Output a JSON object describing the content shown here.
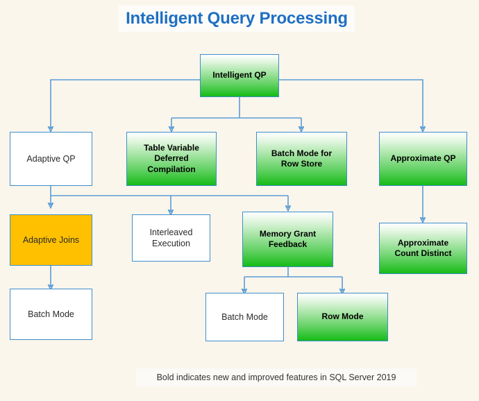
{
  "header": {
    "title": "Intelligent Query Processing"
  },
  "footer": {
    "caption": "Bold indicates new and improved features in SQL Server 2019"
  },
  "colors": {
    "background": "#faf6ec",
    "title_text": "#1f6fc4",
    "node_border": "#3d8ecb",
    "connector": "#5b9bd5",
    "arrowhead": "#2e75b6",
    "green_node_top": "#ffffff",
    "green_node_bottom": "#16bb16",
    "orange_node": "#ffc000",
    "plain_node": "#ffffff"
  },
  "legend": {
    "bold_meaning": "Bold indicates new and improved features in SQL Server 2019"
  },
  "chart_data": {
    "type": "diagram",
    "title": "Intelligent Query Processing",
    "nodes": [
      {
        "id": "intelligent-qp",
        "label": "Intelligent QP",
        "style": "green",
        "level": 0
      },
      {
        "id": "adaptive-qp",
        "label": "Adaptive QP",
        "style": "plain",
        "level": 1
      },
      {
        "id": "table-variable",
        "label": "Table Variable Deferred Compilation",
        "style": "green",
        "level": 1
      },
      {
        "id": "batch-mode-row-store",
        "label": "Batch Mode for Row Store",
        "style": "green",
        "level": 1
      },
      {
        "id": "approximate-qp",
        "label": "Approximate QP",
        "style": "green",
        "level": 1
      },
      {
        "id": "adaptive-joins",
        "label": "Adaptive Joins",
        "style": "orange",
        "level": 2
      },
      {
        "id": "interleaved-execution",
        "label": "Interleaved Execution",
        "style": "plain",
        "level": 2
      },
      {
        "id": "memory-grant-feedback",
        "label": "Memory Grant Feedback",
        "style": "green",
        "level": 2
      },
      {
        "id": "approximate-count",
        "label": "Approximate Count Distinct",
        "style": "green",
        "level": 2
      },
      {
        "id": "batch-mode-aj",
        "label": "Batch Mode",
        "style": "plain",
        "level": 3
      },
      {
        "id": "batch-mode-mgf",
        "label": "Batch Mode",
        "style": "plain",
        "level": 3
      },
      {
        "id": "row-mode-mgf",
        "label": "Row Mode",
        "style": "green",
        "level": 3
      }
    ],
    "edges": [
      {
        "from": "intelligent-qp",
        "to": "adaptive-qp"
      },
      {
        "from": "intelligent-qp",
        "to": "table-variable"
      },
      {
        "from": "intelligent-qp",
        "to": "batch-mode-row-store"
      },
      {
        "from": "intelligent-qp",
        "to": "approximate-qp"
      },
      {
        "from": "adaptive-qp",
        "to": "adaptive-joins"
      },
      {
        "from": "adaptive-qp",
        "to": "interleaved-execution"
      },
      {
        "from": "adaptive-qp",
        "to": "memory-grant-feedback"
      },
      {
        "from": "approximate-qp",
        "to": "approximate-count"
      },
      {
        "from": "adaptive-joins",
        "to": "batch-mode-aj"
      },
      {
        "from": "memory-grant-feedback",
        "to": "batch-mode-mgf"
      },
      {
        "from": "memory-grant-feedback",
        "to": "row-mode-mgf"
      }
    ]
  },
  "nodes": {
    "intelligent_qp": {
      "label": "Intelligent QP"
    },
    "adaptive_qp": {
      "label": "Adaptive QP"
    },
    "table_variable": {
      "line1": "Table Variable",
      "line2": "Deferred",
      "line3": "Compilation"
    },
    "batch_mode_row_store": {
      "line1": "Batch Mode for",
      "line2": "Row Store"
    },
    "approximate_qp": {
      "label": "Approximate QP"
    },
    "adaptive_joins": {
      "label": "Adaptive Joins"
    },
    "interleaved_execution": {
      "line1": "Interleaved",
      "line2": "Execution"
    },
    "memory_grant_feedback": {
      "line1": "Memory Grant",
      "line2": "Feedback"
    },
    "approximate_count": {
      "line1": "Approximate",
      "line2": "Count Distinct"
    },
    "batch_mode_aj": {
      "label": "Batch Mode"
    },
    "batch_mode_mgf": {
      "label": "Batch Mode"
    },
    "row_mode_mgf": {
      "label": "Row Mode"
    }
  }
}
